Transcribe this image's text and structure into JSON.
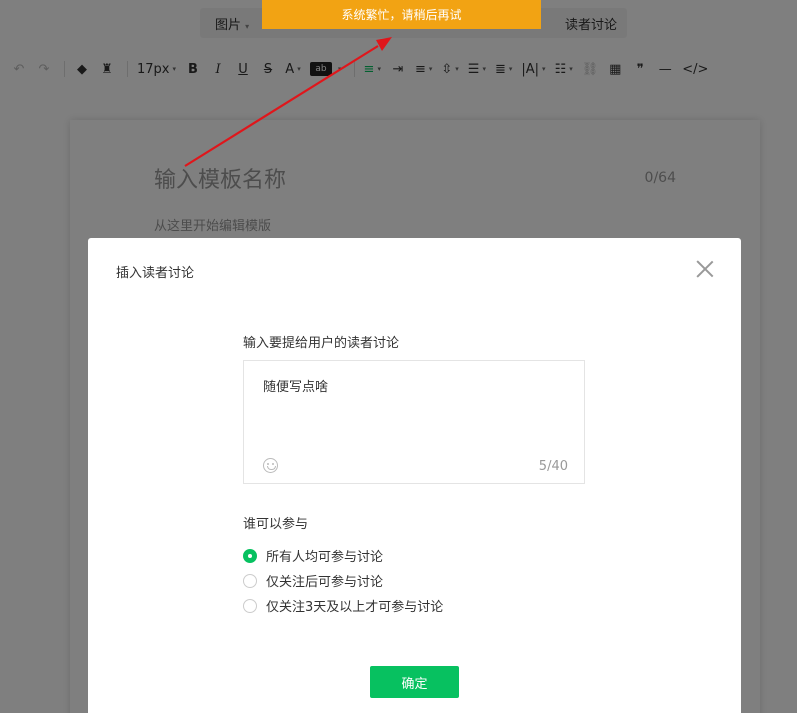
{
  "colors": {
    "accent": "#07c160",
    "toast": "#f2a313",
    "annotation": "#e0161b"
  },
  "menubar": {
    "item_image": "图片",
    "item_reader_discussion": "读者讨论",
    "caret": "▾"
  },
  "toolbar": {
    "undo_icon": "↶",
    "redo_icon": "↷",
    "format_brush_icon": "◆",
    "clear_format_icon": "♜",
    "font_size": "17px",
    "caret": "▾",
    "bold": "B",
    "italic": "I",
    "underline": "U",
    "strikethrough": "S",
    "font_color": "A",
    "bg_color": "ab",
    "align_icon": "≡",
    "indent_icon": "⇥",
    "center_icon": "≡",
    "spacing_icon": "⇳",
    "line_height_icon": "☰",
    "para_icon": "≣",
    "letter_spacing_icon": "|A|",
    "list_icon": "☷",
    "link_icon": "⛓",
    "table_icon": "▦",
    "quote_icon": "❞",
    "hr_icon": "—",
    "code_icon": "</>"
  },
  "editor": {
    "title_placeholder": "输入模板名称",
    "title_counter": "0/64",
    "body_placeholder": "从这里开始编辑模版"
  },
  "toast": {
    "message": "系统繁忙，请稍后再试"
  },
  "dialog": {
    "title": "插入读者讨论",
    "input_label": "输入要提给用户的读者讨论",
    "input_value": "随便写点啥",
    "input_counter": "5/40",
    "who_label": "谁可以参与",
    "options": [
      {
        "label": "所有人均可参与讨论",
        "selected": true
      },
      {
        "label": "仅关注后可参与讨论",
        "selected": false
      },
      {
        "label": "仅关注3天及以上才可参与讨论",
        "selected": false
      }
    ],
    "confirm_label": "确定"
  }
}
